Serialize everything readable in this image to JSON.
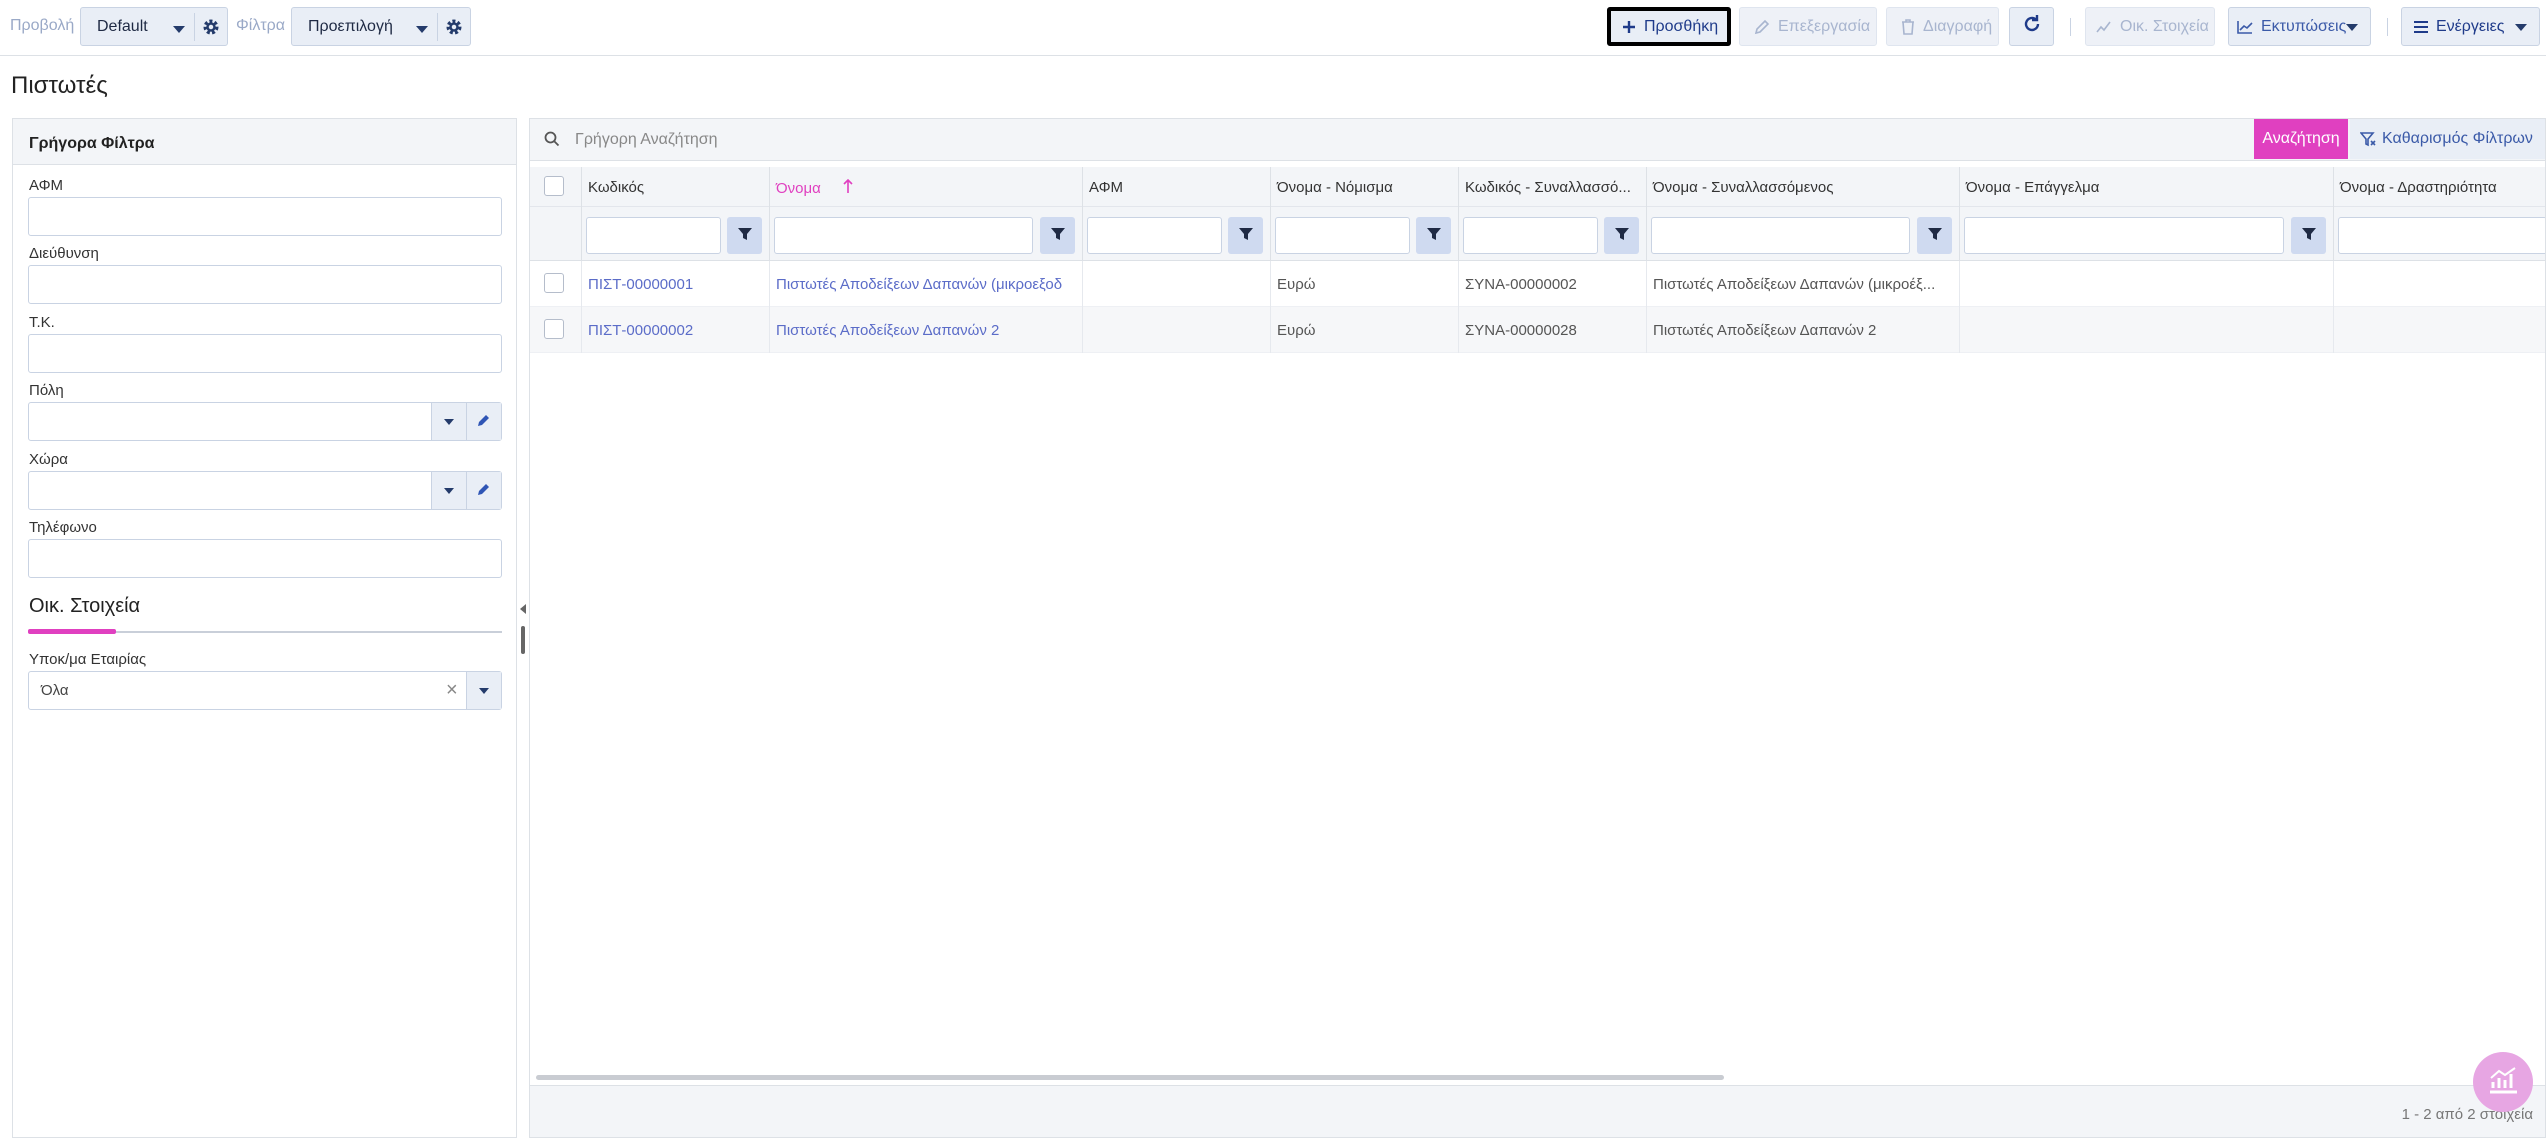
{
  "toolbar": {
    "view_label": "Προβολή",
    "view_value": "Default",
    "filters_label": "Φίλτρα",
    "filters_value": "Προεπιλογή",
    "add_label": "Προσθήκη",
    "edit_label": "Επεξεργασία",
    "delete_label": "Διαγραφή",
    "financial_label": "Οικ. Στοιχεία",
    "prints_label": "Εκτυπώσεις",
    "actions_label": "Ενέργειες"
  },
  "page": {
    "title": "Πιστωτές"
  },
  "quick_filters": {
    "header": "Γρήγορα Φίλτρα",
    "afm_label": "ΑΦΜ",
    "address_label": "Διεύθυνση",
    "postal_label": "Τ.Κ.",
    "city_label": "Πόλη",
    "country_label": "Χώρα",
    "phone_label": "Τηλέφωνο",
    "section_title": "Οικ. Στοιχεία",
    "company_branch_label": "Υποκ/μα Εταιρίας",
    "company_branch_value": "Όλα"
  },
  "search": {
    "placeholder": "Γρήγορη Αναζήτηση",
    "search_button": "Αναζήτηση",
    "clear_filters_button": "Καθαρισμός Φίλτρων"
  },
  "grid": {
    "columns": [
      "Κωδικός",
      "Όνομα",
      "ΑΦΜ",
      "Όνομα - Νόμισμα",
      "Κωδικός - Συναλλασσό...",
      "Όνομα - Συναλλασσόμενος",
      "Όνομα - Επάγγελμα",
      "Όνομα - Δραστηριότητα"
    ],
    "sorted_column": "Όνομα",
    "sort_direction": "ascending",
    "rows": [
      {
        "code": "ΠΙΣΤ-00000001",
        "name": "Πιστωτές Αποδείξεων Δαπανών (μικροεξοδ",
        "afm": "",
        "currency": "Ευρώ",
        "partner_code": "ΣΥΝΑ-00000002",
        "partner_name": "Πιστωτές Αποδείξεων Δαπανών (μικροέξ...",
        "profession": "",
        "activity": ""
      },
      {
        "code": "ΠΙΣΤ-00000002",
        "name": "Πιστωτές Αποδείξεων Δαπανών 2",
        "afm": "",
        "currency": "Ευρώ",
        "partner_code": "ΣΥΝΑ-00000028",
        "partner_name": "Πιστωτές Αποδείξεων Δαπανών 2",
        "profession": "",
        "activity": ""
      }
    ],
    "footer": "1 - 2 από 2 στοιχεία"
  },
  "colors": {
    "accent": "#e040c0",
    "link": "#5b6cc8",
    "button_bg": "#e9eef6"
  }
}
